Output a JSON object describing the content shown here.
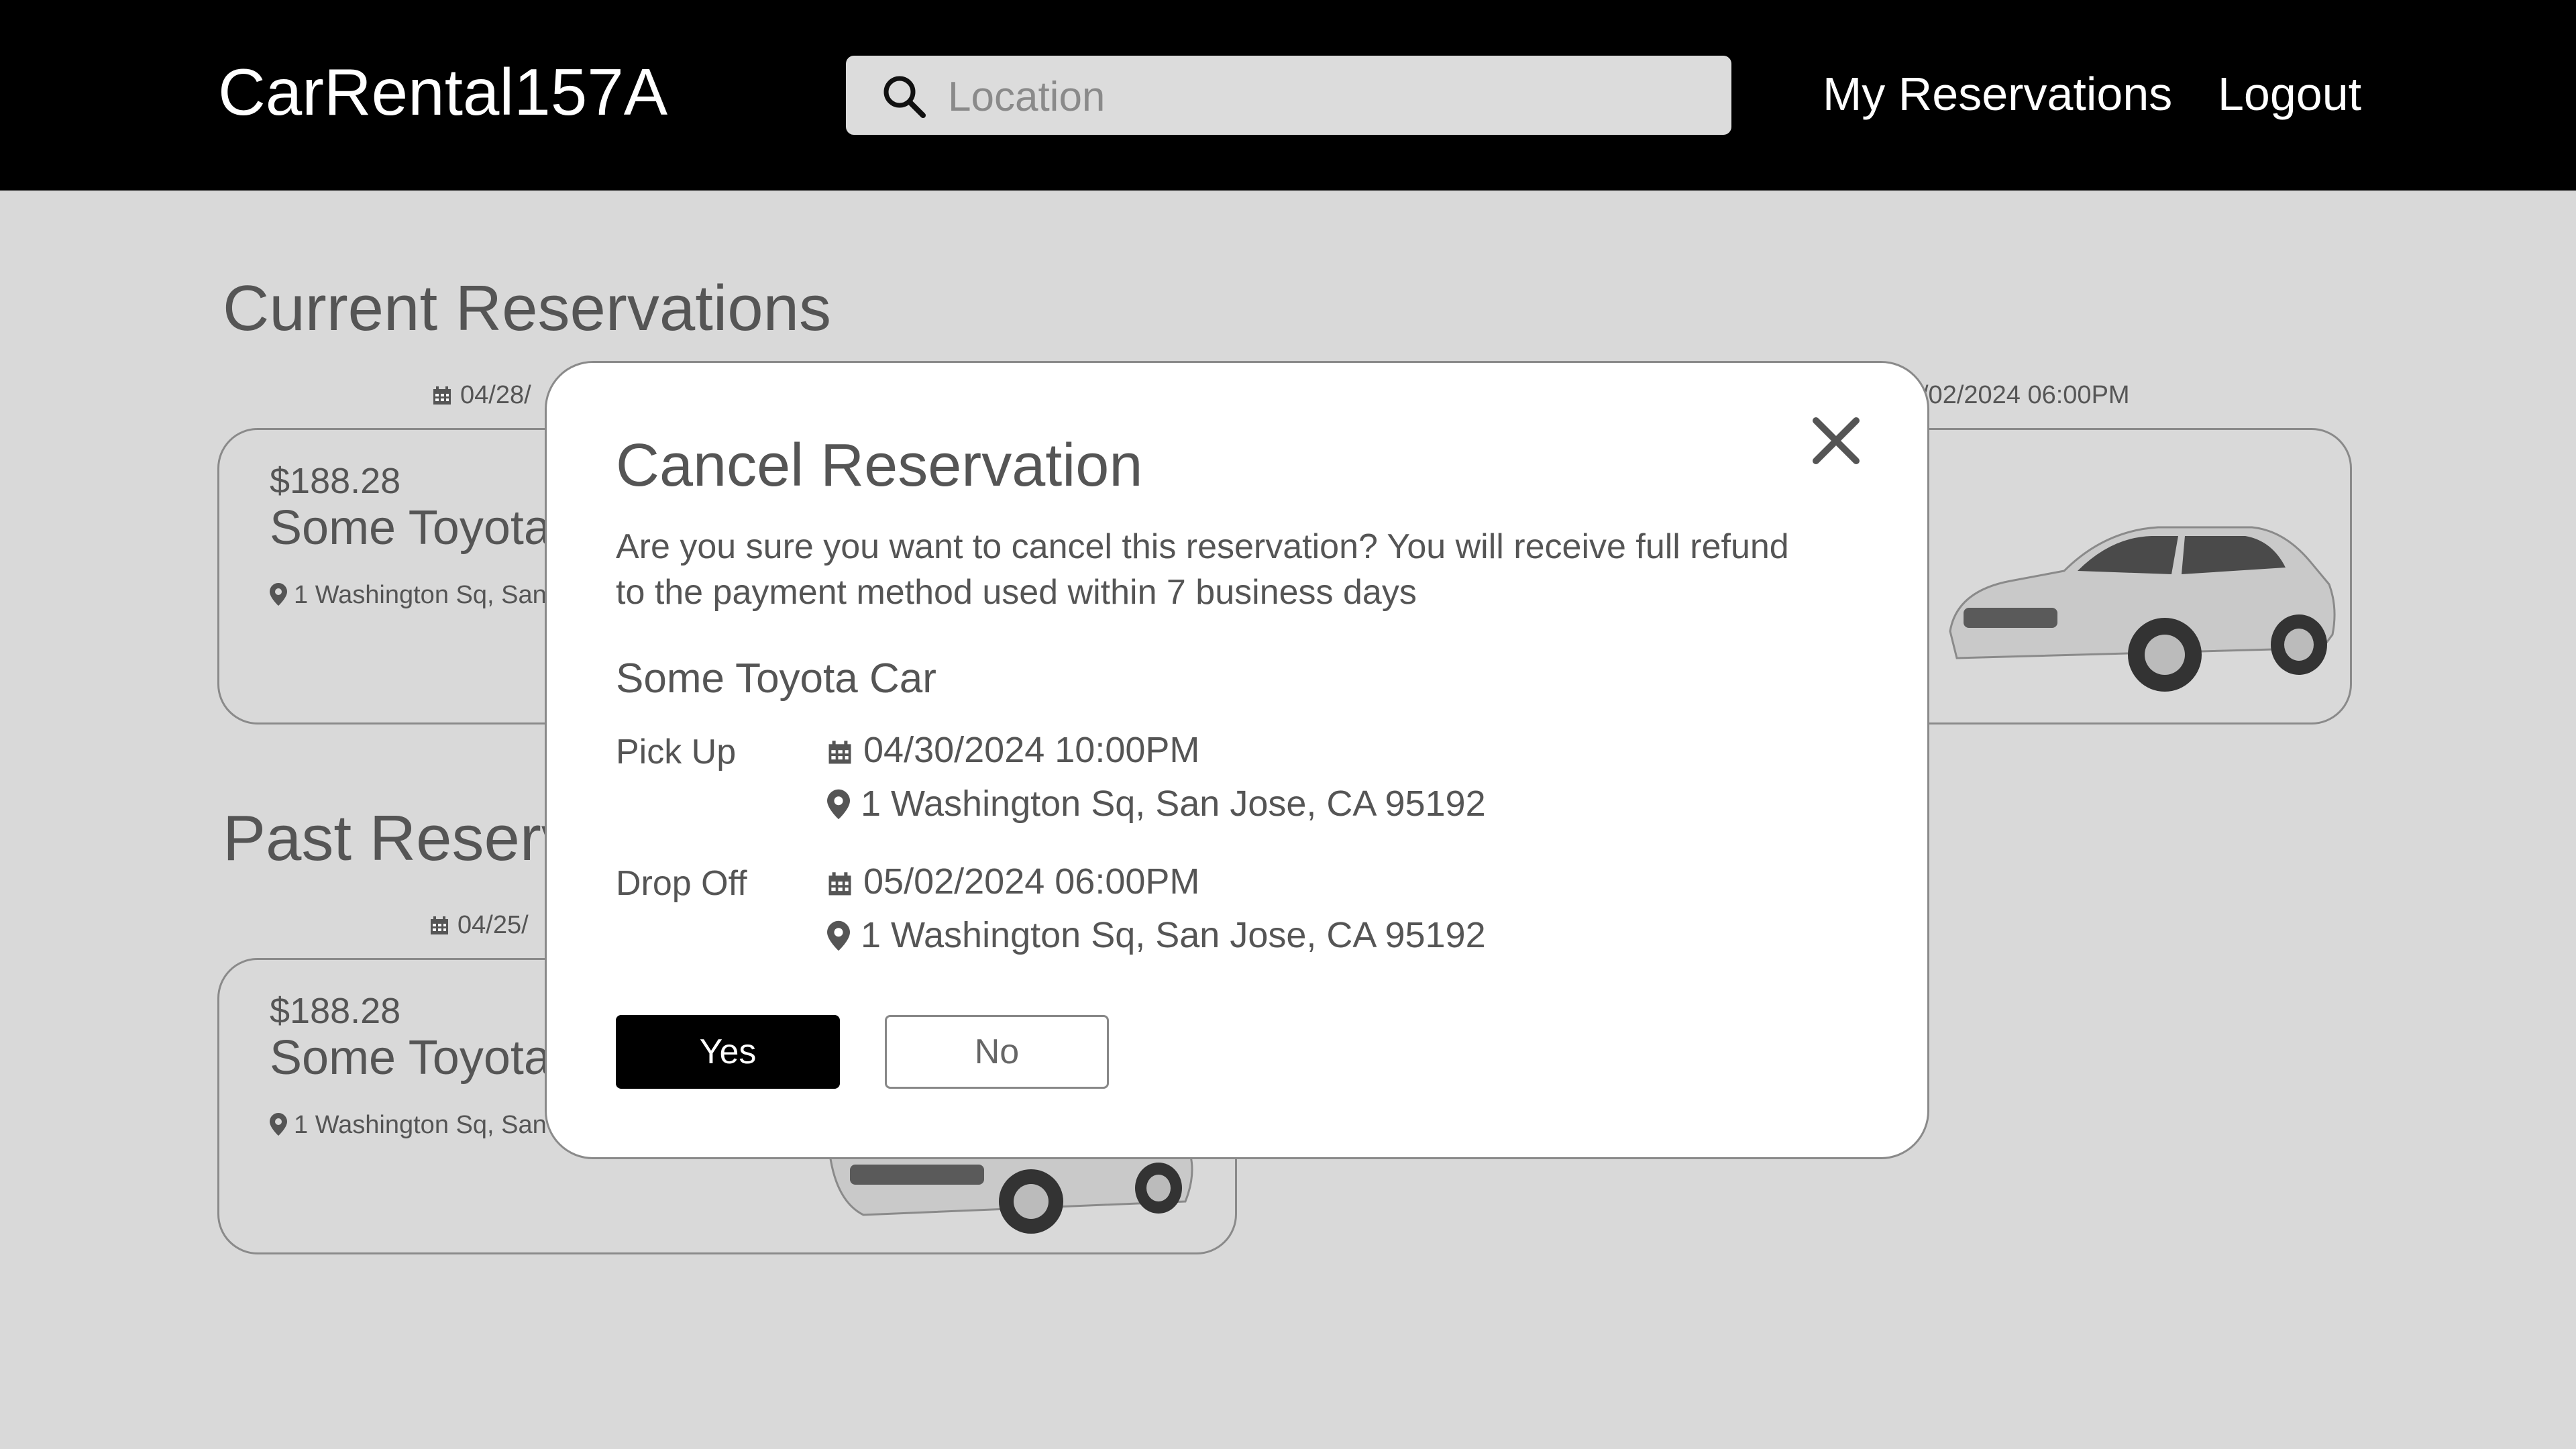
{
  "header": {
    "brand": "CarRental157A",
    "search_placeholder": "Location",
    "nav": [
      "My Reservations",
      "Logout"
    ]
  },
  "current": {
    "title": "Current Reservations",
    "card": {
      "date_left": "04/28/",
      "date_right": "/02/2024 06:00PM",
      "price": "$188.28",
      "name": "Some Toyota",
      "location": "1 Washington Sq,  San J"
    }
  },
  "past": {
    "title": "Past Reserv",
    "card": {
      "date_left": "04/25/",
      "price": "$188.28",
      "name": "Some Toyota",
      "location": "1 Washington Sq,  San J"
    }
  },
  "modal": {
    "title": "Cancel Reservation",
    "message": "Are you sure you want to cancel this reservation? You will receive full refund to the payment method used within 7 business days",
    "car_name": "Some Toyota Car",
    "pickup": {
      "label": "Pick Up",
      "datetime": "04/30/2024 10:00PM",
      "location": "1 Washington Sq,  San Jose, CA 95192"
    },
    "dropoff": {
      "label": "Drop Off",
      "datetime": "05/02/2024 06:00PM",
      "location": "1 Washington Sq,  San Jose, CA 95192"
    },
    "yes_label": "Yes",
    "no_label": "No"
  },
  "icons": [
    "search-icon",
    "calendar-icon",
    "location-pin-icon",
    "close-icon"
  ],
  "colors": {
    "header_bg": "#000000",
    "page_bg": "#d9d9d9",
    "primary_button": "#000000"
  }
}
